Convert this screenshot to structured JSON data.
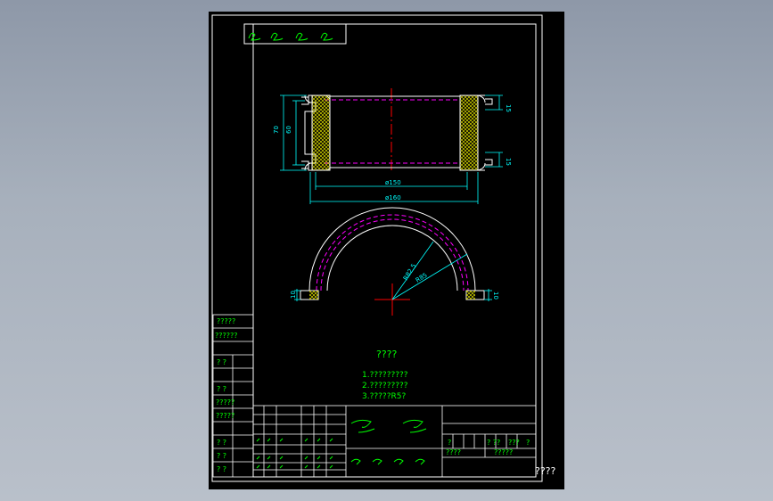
{
  "notes": {
    "heading": "????",
    "items": [
      "1.?????????",
      "2.?????????",
      "3.?????R5?"
    ]
  },
  "dimensions": {
    "overall_height": "70",
    "inner_height": "60",
    "flange_top": "15",
    "flange_bottom": "15",
    "inner_diameter": "ø150",
    "outer_diameter": "ø160",
    "inner_radius": "R82.5",
    "outer_radius": "R85",
    "foot_left": "10",
    "foot_right": "10"
  },
  "side_table": [
    "?????",
    "??????",
    "? ?",
    "? ?",
    "?????",
    "?????",
    "? ?",
    "? ?",
    "? ?"
  ],
  "title_block": {
    "material_mark": "?",
    "scale_labels": [
      "? ??",
      "???",
      "?"
    ],
    "bottom_labels": [
      "????",
      "?????"
    ],
    "outside_label": "????"
  },
  "colors": {
    "frame": "#ffffff",
    "outline": "#ffffff",
    "text": "#00ff00",
    "dimension": "#00ffff",
    "hidden": "#ff00ff",
    "center": "#ff0000",
    "hatch": "#ffff00"
  }
}
